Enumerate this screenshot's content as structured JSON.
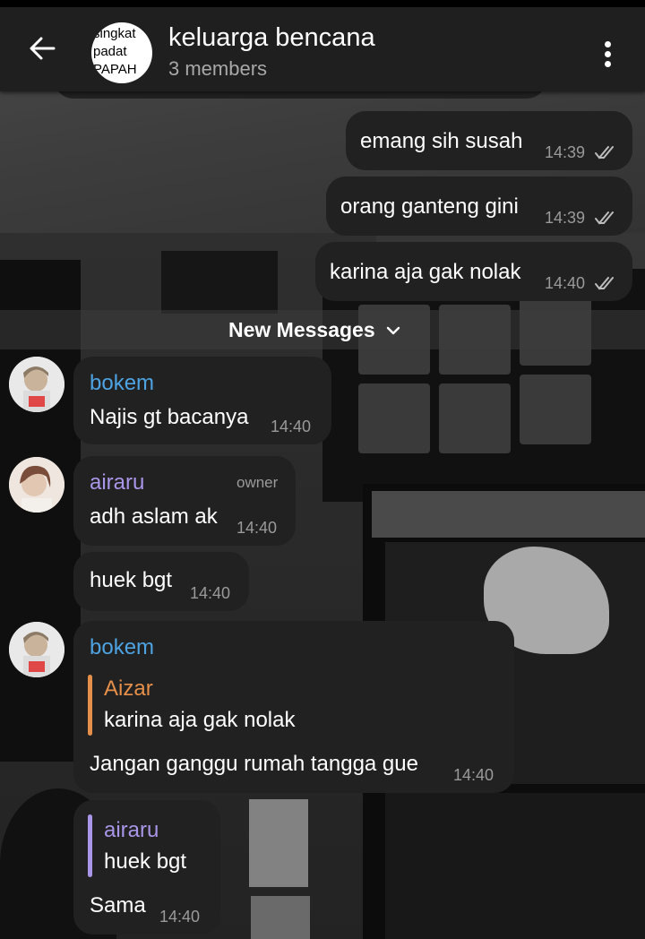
{
  "header": {
    "title": "keluarga bencana",
    "subtitle": "3 members",
    "group_avatar_lines": [
      "singkat",
      "padat",
      "PAPAH"
    ]
  },
  "divider": {
    "label": "New Messages"
  },
  "messages": [
    {
      "id": "m1",
      "direction": "out",
      "text": "emang sih susah",
      "time": "14:39",
      "status": "read"
    },
    {
      "id": "m2",
      "direction": "out",
      "text": "orang ganteng gini",
      "time": "14:39",
      "status": "read"
    },
    {
      "id": "m3",
      "direction": "out",
      "text": "karina aja gak nolak",
      "time": "14:40",
      "status": "read"
    },
    {
      "id": "m4",
      "direction": "in",
      "sender": "bokem",
      "text": "Najis gt bacanya",
      "time": "14:40"
    },
    {
      "id": "m5",
      "direction": "in",
      "sender": "airaru",
      "role": "owner",
      "text": "adh aslam ak",
      "time": "14:40"
    },
    {
      "id": "m6",
      "direction": "in",
      "text": "huek bgt",
      "time": "14:40"
    },
    {
      "id": "m7",
      "direction": "in",
      "sender": "bokem",
      "reply_to": {
        "name": "Aizar",
        "text": "karina aja gak nolak"
      },
      "text": "Jangan ganggu rumah tangga gue",
      "time": "14:40"
    },
    {
      "id": "m8",
      "direction": "in",
      "reply_to": {
        "name": "airaru",
        "text": "huek bgt"
      },
      "text": "Sama",
      "time": "14:40"
    }
  ],
  "colors": {
    "header_bg": "#1f1f1f",
    "bubble_bg": "#212121",
    "sender_bokem": "#4ea3e2",
    "sender_airaru": "#a996e8",
    "reply_aizar": "#e58f4a"
  },
  "icons": [
    "back-arrow-icon",
    "more-vertical-icon",
    "double-check-icon",
    "chevron-down-icon"
  ]
}
